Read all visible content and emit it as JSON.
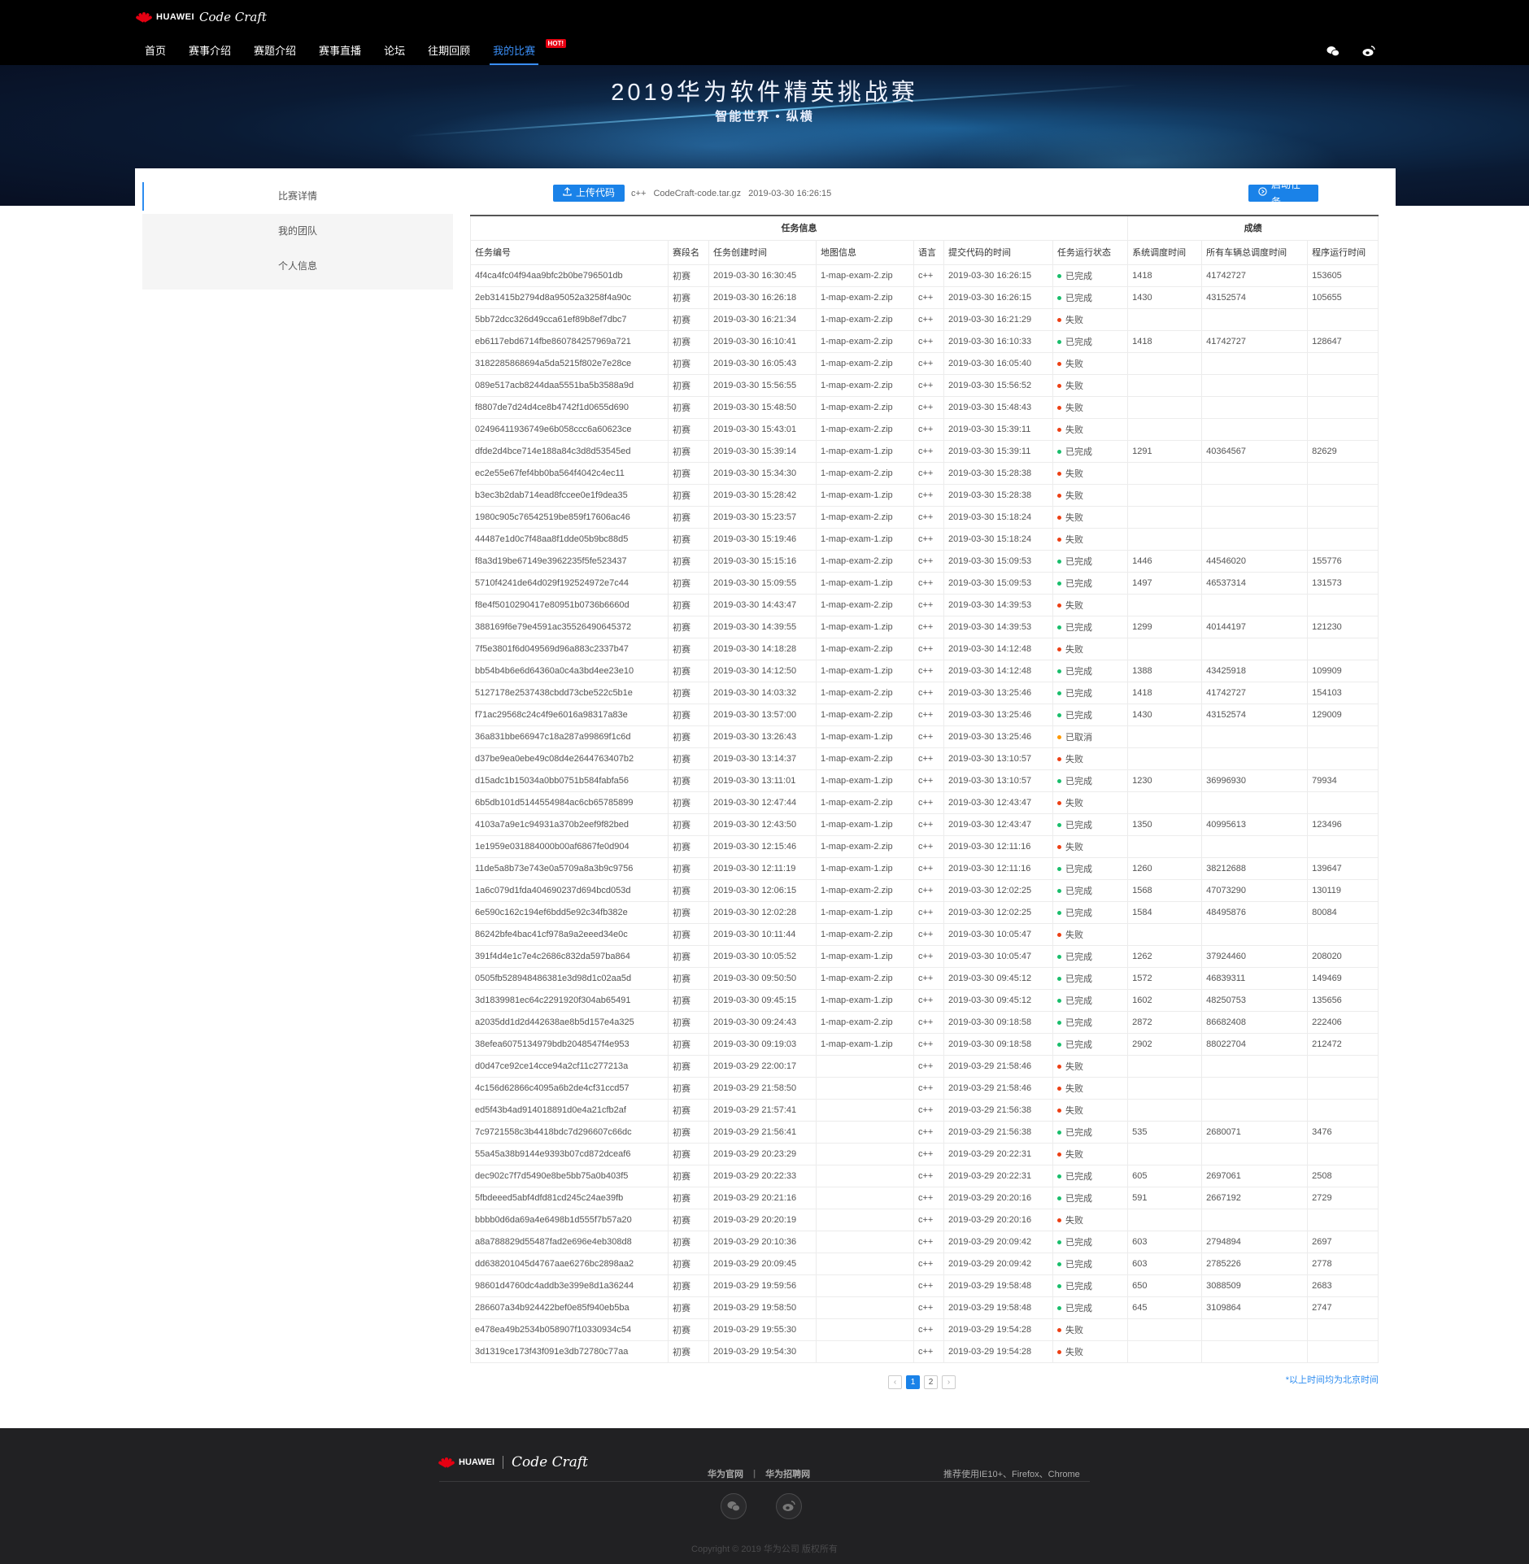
{
  "header": {
    "brand": "HUAWEI",
    "product": "Code Craft",
    "nav": [
      {
        "label": "首页"
      },
      {
        "label": "赛事介绍"
      },
      {
        "label": "赛题介绍"
      },
      {
        "label": "赛事直播"
      },
      {
        "label": "论坛"
      },
      {
        "label": "往期回顾"
      },
      {
        "label": "我的比赛",
        "badge": "HOT!"
      }
    ],
    "active_nav": "我的比赛",
    "social": [
      "wechat-icon",
      "weibo-icon"
    ]
  },
  "banner": {
    "title": "2019华为软件精英挑战赛",
    "subtitle": "智能世界 • 纵横"
  },
  "sidebar": {
    "items": [
      {
        "label": "比赛详情",
        "active": true
      },
      {
        "label": "我的团队",
        "active": false
      },
      {
        "label": "个人信息",
        "active": false
      }
    ]
  },
  "toolbar": {
    "upload_label": "上传代码",
    "lang": "c++",
    "file_name": "CodeCraft-code.tar.gz",
    "file_time": "2019-03-30 16:26:15",
    "start_label": "启动任务"
  },
  "table": {
    "group_headers": [
      "任务信息",
      "成绩"
    ],
    "columns": [
      "任务编号",
      "赛段名",
      "任务创建时间",
      "地图信息",
      "语言",
      "提交代码的时间",
      "任务运行状态",
      "系统调度时间",
      "所有车辆总调度时间",
      "程序运行时间"
    ],
    "status_colors": {
      "已完成": "#19be6b",
      "失败": "#ed3f14",
      "已取消": "#ff9900"
    },
    "rows": [
      [
        "4f4ca4fc04f94aa9bfc2b0be796501db",
        "初赛",
        "2019-03-30 16:30:45",
        "1-map-exam-2.zip",
        "c++",
        "2019-03-30 16:26:15",
        "已完成",
        "1418",
        "41742727",
        "153605"
      ],
      [
        "2eb31415b2794d8a95052a3258f4a90c",
        "初赛",
        "2019-03-30 16:26:18",
        "1-map-exam-2.zip",
        "c++",
        "2019-03-30 16:26:15",
        "已完成",
        "1430",
        "43152574",
        "105655"
      ],
      [
        "5bb72dcc326d49cca61ef89b8ef7dbc7",
        "初赛",
        "2019-03-30 16:21:34",
        "1-map-exam-2.zip",
        "c++",
        "2019-03-30 16:21:29",
        "失败",
        "",
        "",
        ""
      ],
      [
        "eb6117ebd6714fbe860784257969a721",
        "初赛",
        "2019-03-30 16:10:41",
        "1-map-exam-2.zip",
        "c++",
        "2019-03-30 16:10:33",
        "已完成",
        "1418",
        "41742727",
        "128647"
      ],
      [
        "3182285868694a5da5215f802e7e28ce",
        "初赛",
        "2019-03-30 16:05:43",
        "1-map-exam-2.zip",
        "c++",
        "2019-03-30 16:05:40",
        "失败",
        "",
        "",
        ""
      ],
      [
        "089e517acb8244daa5551ba5b3588a9d",
        "初赛",
        "2019-03-30 15:56:55",
        "1-map-exam-2.zip",
        "c++",
        "2019-03-30 15:56:52",
        "失败",
        "",
        "",
        ""
      ],
      [
        "f8807de7d24d4ce8b4742f1d0655d690",
        "初赛",
        "2019-03-30 15:48:50",
        "1-map-exam-2.zip",
        "c++",
        "2019-03-30 15:48:43",
        "失败",
        "",
        "",
        ""
      ],
      [
        "02496411936749e6b058ccc6a60623ce",
        "初赛",
        "2019-03-30 15:43:01",
        "1-map-exam-2.zip",
        "c++",
        "2019-03-30 15:39:11",
        "失败",
        "",
        "",
        ""
      ],
      [
        "dfde2d4bce714e188a84c3d8d53545ed",
        "初赛",
        "2019-03-30 15:39:14",
        "1-map-exam-1.zip",
        "c++",
        "2019-03-30 15:39:11",
        "已完成",
        "1291",
        "40364567",
        "82629"
      ],
      [
        "ec2e55e67fef4bb0ba564f4042c4ec11",
        "初赛",
        "2019-03-30 15:34:30",
        "1-map-exam-2.zip",
        "c++",
        "2019-03-30 15:28:38",
        "失败",
        "",
        "",
        ""
      ],
      [
        "b3ec3b2dab714ead8fccee0e1f9dea35",
        "初赛",
        "2019-03-30 15:28:42",
        "1-map-exam-1.zip",
        "c++",
        "2019-03-30 15:28:38",
        "失败",
        "",
        "",
        ""
      ],
      [
        "1980c905c76542519be859f17606ac46",
        "初赛",
        "2019-03-30 15:23:57",
        "1-map-exam-2.zip",
        "c++",
        "2019-03-30 15:18:24",
        "失败",
        "",
        "",
        ""
      ],
      [
        "44487e1d0c7f48aa8f1dde05b9bc88d5",
        "初赛",
        "2019-03-30 15:19:46",
        "1-map-exam-1.zip",
        "c++",
        "2019-03-30 15:18:24",
        "失败",
        "",
        "",
        ""
      ],
      [
        "f8a3d19be67149e3962235f5fe523437",
        "初赛",
        "2019-03-30 15:15:16",
        "1-map-exam-2.zip",
        "c++",
        "2019-03-30 15:09:53",
        "已完成",
        "1446",
        "44546020",
        "155776"
      ],
      [
        "5710f4241de64d029f192524972e7c44",
        "初赛",
        "2019-03-30 15:09:55",
        "1-map-exam-1.zip",
        "c++",
        "2019-03-30 15:09:53",
        "已完成",
        "1497",
        "46537314",
        "131573"
      ],
      [
        "f8e4f5010290417e80951b0736b6660d",
        "初赛",
        "2019-03-30 14:43:47",
        "1-map-exam-2.zip",
        "c++",
        "2019-03-30 14:39:53",
        "失败",
        "",
        "",
        ""
      ],
      [
        "388169f6e79e4591ac35526490645372",
        "初赛",
        "2019-03-30 14:39:55",
        "1-map-exam-1.zip",
        "c++",
        "2019-03-30 14:39:53",
        "已完成",
        "1299",
        "40144197",
        "121230"
      ],
      [
        "7f5e3801f6d049569d96a883c2337b47",
        "初赛",
        "2019-03-30 14:18:28",
        "1-map-exam-2.zip",
        "c++",
        "2019-03-30 14:12:48",
        "失败",
        "",
        "",
        ""
      ],
      [
        "bb54b4b6e6d64360a0c4a3bd4ee23e10",
        "初赛",
        "2019-03-30 14:12:50",
        "1-map-exam-1.zip",
        "c++",
        "2019-03-30 14:12:48",
        "已完成",
        "1388",
        "43425918",
        "109909"
      ],
      [
        "5127178e2537438cbdd73cbe522c5b1e",
        "初赛",
        "2019-03-30 14:03:32",
        "1-map-exam-2.zip",
        "c++",
        "2019-03-30 13:25:46",
        "已完成",
        "1418",
        "41742727",
        "154103"
      ],
      [
        "f71ac29568c24c4f9e6016a98317a83e",
        "初赛",
        "2019-03-30 13:57:00",
        "1-map-exam-2.zip",
        "c++",
        "2019-03-30 13:25:46",
        "已完成",
        "1430",
        "43152574",
        "129009"
      ],
      [
        "36a831bbe66947c18a287a99869f1c6d",
        "初赛",
        "2019-03-30 13:26:43",
        "1-map-exam-1.zip",
        "c++",
        "2019-03-30 13:25:46",
        "已取消",
        "",
        "",
        ""
      ],
      [
        "d37be9ea0ebe49c08d4e2644763407b2",
        "初赛",
        "2019-03-30 13:14:37",
        "1-map-exam-2.zip",
        "c++",
        "2019-03-30 13:10:57",
        "失败",
        "",
        "",
        ""
      ],
      [
        "d15adc1b15034a0bb0751b584fabfa56",
        "初赛",
        "2019-03-30 13:11:01",
        "1-map-exam-1.zip",
        "c++",
        "2019-03-30 13:10:57",
        "已完成",
        "1230",
        "36996930",
        "79934"
      ],
      [
        "6b5db101d5144554984ac6cb65785899",
        "初赛",
        "2019-03-30 12:47:44",
        "1-map-exam-2.zip",
        "c++",
        "2019-03-30 12:43:47",
        "失败",
        "",
        "",
        ""
      ],
      [
        "4103a7a9e1c94931a370b2eef9f82bed",
        "初赛",
        "2019-03-30 12:43:50",
        "1-map-exam-1.zip",
        "c++",
        "2019-03-30 12:43:47",
        "已完成",
        "1350",
        "40995613",
        "123496"
      ],
      [
        "1e1959e031884000b00af6867fe0d904",
        "初赛",
        "2019-03-30 12:15:46",
        "1-map-exam-2.zip",
        "c++",
        "2019-03-30 12:11:16",
        "失败",
        "",
        "",
        ""
      ],
      [
        "11de5a8b73e743e0a5709a8a3b9c9756",
        "初赛",
        "2019-03-30 12:11:19",
        "1-map-exam-1.zip",
        "c++",
        "2019-03-30 12:11:16",
        "已完成",
        "1260",
        "38212688",
        "139647"
      ],
      [
        "1a6c079d1fda404690237d694bcd053d",
        "初赛",
        "2019-03-30 12:06:15",
        "1-map-exam-2.zip",
        "c++",
        "2019-03-30 12:02:25",
        "已完成",
        "1568",
        "47073290",
        "130119"
      ],
      [
        "6e590c162c194ef6bdd5e92c34fb382e",
        "初赛",
        "2019-03-30 12:02:28",
        "1-map-exam-1.zip",
        "c++",
        "2019-03-30 12:02:25",
        "已完成",
        "1584",
        "48495876",
        "80084"
      ],
      [
        "86242bfe4bac41cf978a9a2eeed34e0c",
        "初赛",
        "2019-03-30 10:11:44",
        "1-map-exam-2.zip",
        "c++",
        "2019-03-30 10:05:47",
        "失败",
        "",
        "",
        ""
      ],
      [
        "391f4d4e1c7e4c2686c832da597ba864",
        "初赛",
        "2019-03-30 10:05:52",
        "1-map-exam-1.zip",
        "c++",
        "2019-03-30 10:05:47",
        "已完成",
        "1262",
        "37924460",
        "208020"
      ],
      [
        "0505fb528948486381e3d98d1c02aa5d",
        "初赛",
        "2019-03-30 09:50:50",
        "1-map-exam-2.zip",
        "c++",
        "2019-03-30 09:45:12",
        "已完成",
        "1572",
        "46839311",
        "149469"
      ],
      [
        "3d1839981ec64c2291920f304ab65491",
        "初赛",
        "2019-03-30 09:45:15",
        "1-map-exam-1.zip",
        "c++",
        "2019-03-30 09:45:12",
        "已完成",
        "1602",
        "48250753",
        "135656"
      ],
      [
        "a2035dd1d2d442638ae8b5d157e4a325",
        "初赛",
        "2019-03-30 09:24:43",
        "1-map-exam-2.zip",
        "c++",
        "2019-03-30 09:18:58",
        "已完成",
        "2872",
        "86682408",
        "222406"
      ],
      [
        "38efea6075134979bdb2048547f4e953",
        "初赛",
        "2019-03-30 09:19:03",
        "1-map-exam-1.zip",
        "c++",
        "2019-03-30 09:18:58",
        "已完成",
        "2902",
        "88022704",
        "212472"
      ],
      [
        "d0d47ce92ce14cce94a2cf11c277213a",
        "初赛",
        "2019-03-29 22:00:17",
        "",
        "c++",
        "2019-03-29 21:58:46",
        "失败",
        "",
        "",
        ""
      ],
      [
        "4c156d62866c4095a6b2de4cf31ccd57",
        "初赛",
        "2019-03-29 21:58:50",
        "",
        "c++",
        "2019-03-29 21:58:46",
        "失败",
        "",
        "",
        ""
      ],
      [
        "ed5f43b4ad914018891d0e4a21cfb2af",
        "初赛",
        "2019-03-29 21:57:41",
        "",
        "c++",
        "2019-03-29 21:56:38",
        "失败",
        "",
        "",
        ""
      ],
      [
        "7c9721558c3b4418bdc7d296607c66dc",
        "初赛",
        "2019-03-29 21:56:41",
        "",
        "c++",
        "2019-03-29 21:56:38",
        "已完成",
        "535",
        "2680071",
        "3476"
      ],
      [
        "55a45a38b9144e9393b07cd872dceaf6",
        "初赛",
        "2019-03-29 20:23:29",
        "",
        "c++",
        "2019-03-29 20:22:31",
        "失败",
        "",
        "",
        ""
      ],
      [
        "dec902c7f7d5490e8be5bb75a0b403f5",
        "初赛",
        "2019-03-29 20:22:33",
        "",
        "c++",
        "2019-03-29 20:22:31",
        "已完成",
        "605",
        "2697061",
        "2508"
      ],
      [
        "5fbdeeed5abf4dfd81cd245c24ae39fb",
        "初赛",
        "2019-03-29 20:21:16",
        "",
        "c++",
        "2019-03-29 20:20:16",
        "已完成",
        "591",
        "2667192",
        "2729"
      ],
      [
        "bbbb0d6da69a4e6498b1d555f7b57a20",
        "初赛",
        "2019-03-29 20:20:19",
        "",
        "c++",
        "2019-03-29 20:20:16",
        "失败",
        "",
        "",
        ""
      ],
      [
        "a8a788829d55487fad2e696e4eb308d8",
        "初赛",
        "2019-03-29 20:10:36",
        "",
        "c++",
        "2019-03-29 20:09:42",
        "已完成",
        "603",
        "2794894",
        "2697"
      ],
      [
        "dd638201045d4767aae6276bc2898aa2",
        "初赛",
        "2019-03-29 20:09:45",
        "",
        "c++",
        "2019-03-29 20:09:42",
        "已完成",
        "603",
        "2785226",
        "2778"
      ],
      [
        "98601d4760dc4addb3e399e8d1a36244",
        "初赛",
        "2019-03-29 19:59:56",
        "",
        "c++",
        "2019-03-29 19:58:48",
        "已完成",
        "650",
        "3088509",
        "2683"
      ],
      [
        "286607a34b924422bef0e85f940eb5ba",
        "初赛",
        "2019-03-29 19:58:50",
        "",
        "c++",
        "2019-03-29 19:58:48",
        "已完成",
        "645",
        "3109864",
        "2747"
      ],
      [
        "e478ea49b2534b058907f10330934c54",
        "初赛",
        "2019-03-29 19:55:30",
        "",
        "c++",
        "2019-03-29 19:54:28",
        "失败",
        "",
        "",
        ""
      ],
      [
        "3d1319ce173f43f091e3db72780c77aa",
        "初赛",
        "2019-03-29 19:54:30",
        "",
        "c++",
        "2019-03-29 19:54:28",
        "失败",
        "",
        "",
        ""
      ]
    ]
  },
  "pagination": {
    "prev": "‹",
    "pages": [
      "1",
      "2"
    ],
    "current": "1",
    "next": "›"
  },
  "note": "*以上时间均为北京时间",
  "footer": {
    "brand": "HUAWEI",
    "product": "Code Craft",
    "links": [
      "华为官网",
      "华为招聘网"
    ],
    "browser_note": "推荐使用IE10+、Firefox、Chrome",
    "social": [
      "wechat-icon",
      "weibo-icon"
    ],
    "copyright": "Copyright © 2019 华为公司  版权所有"
  },
  "colors": {
    "accent": "#1a82e8",
    "header_bg": "#000000",
    "footer_bg": "#212123",
    "hot_badge": "#e60012"
  }
}
